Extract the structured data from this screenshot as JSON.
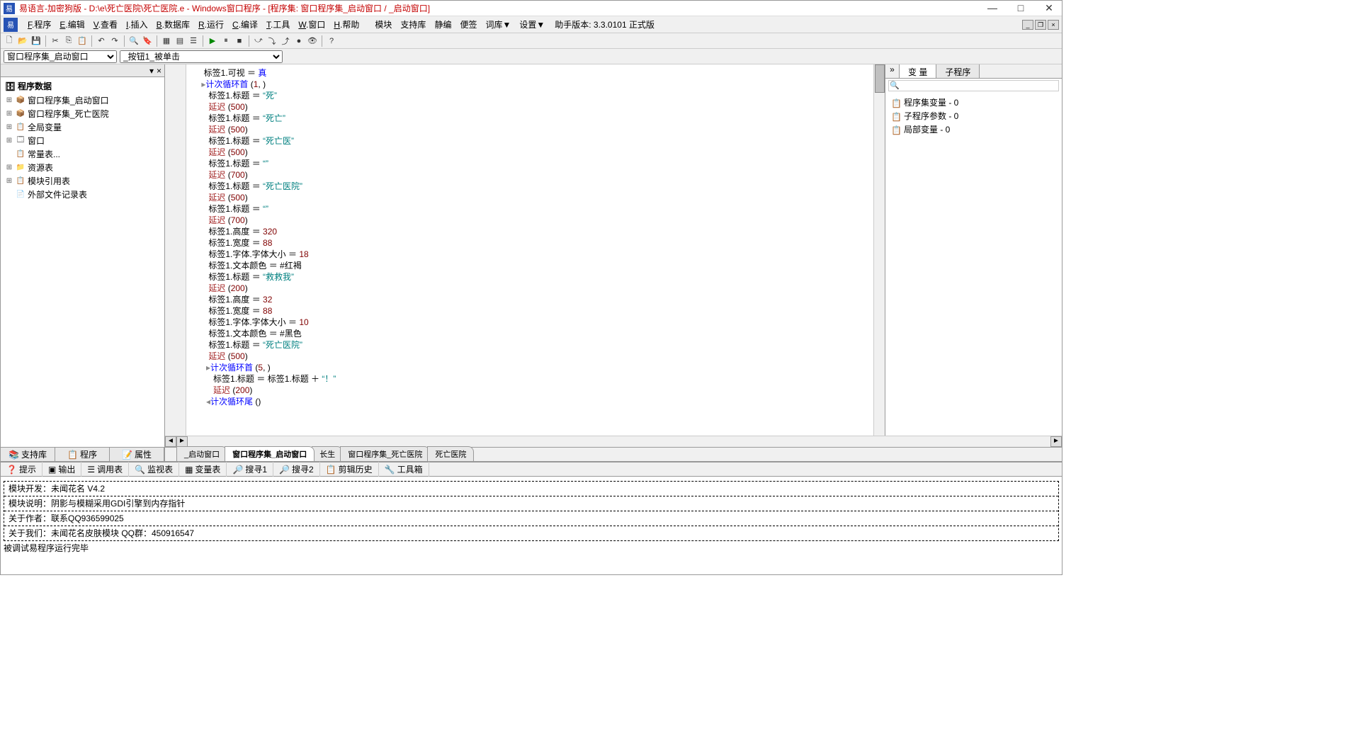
{
  "title": "易语言-加密狗版 - D:\\e\\死亡医院\\死亡医院.e - Windows窗口程序 - [程序集: 窗口程序集_启动窗口 / _启动窗口]",
  "menu": {
    "items": [
      "F.程序",
      "E.编辑",
      "V.查看",
      "I.插入",
      "B.数据库",
      "R.运行",
      "C.编译",
      "T.工具",
      "W.窗口",
      "H.帮助"
    ],
    "extra": [
      "模块",
      "支持库",
      "静编",
      "便签",
      "词库▼",
      "设置▼"
    ],
    "version": "助手版本:  3.3.0101 正式版"
  },
  "dropdowns": {
    "left": "窗口程序集_启动窗口",
    "right": "_按钮1_被单击"
  },
  "tree": {
    "title": "程序数据",
    "nodes": [
      {
        "exp": "+",
        "icon": "📦",
        "label": "窗口程序集_启动窗口"
      },
      {
        "exp": "+",
        "icon": "📦",
        "label": "窗口程序集_死亡医院"
      },
      {
        "exp": "+",
        "icon": "📋",
        "label": "全局变量"
      },
      {
        "exp": "+",
        "icon": "🗔",
        "label": "窗口"
      },
      {
        "exp": "",
        "icon": "📋",
        "label": "常量表..."
      },
      {
        "exp": "+",
        "icon": "📁",
        "label": "资源表"
      },
      {
        "exp": "+",
        "icon": "📋",
        "label": "模块引用表"
      },
      {
        "exp": "",
        "icon": "📄",
        "label": "外部文件记录表"
      }
    ]
  },
  "left_tabs": [
    "支持库",
    "程序",
    "属性"
  ],
  "editor_tabs": [
    {
      "label": "_启动窗口",
      "active": false
    },
    {
      "label": "窗口程序集_启动窗口",
      "active": true
    },
    {
      "label": "长生",
      "active": false
    },
    {
      "label": "窗口程序集_死亡医院",
      "active": false
    },
    {
      "label": "死亡医院",
      "active": false
    }
  ],
  "code_lines": [
    {
      "indent": 2,
      "parts": [
        {
          "t": "标签1.可视",
          "c": "black"
        },
        {
          "t": " ＝ ",
          "c": "op"
        },
        {
          "t": "真",
          "c": "blue"
        }
      ]
    },
    {
      "indent": 2,
      "flow": "start",
      "parts": [
        {
          "t": "计次循环首",
          "c": "blue"
        },
        {
          "t": " (",
          "c": "black"
        },
        {
          "t": "1",
          "c": "red"
        },
        {
          "t": ", )",
          "c": "black"
        }
      ]
    },
    {
      "indent": 3,
      "parts": [
        {
          "t": "标签1.标题",
          "c": "black"
        },
        {
          "t": " ＝ ",
          "c": "op"
        },
        {
          "t": "“死”",
          "c": "teal"
        }
      ]
    },
    {
      "indent": 3,
      "parts": [
        {
          "t": "延迟",
          "c": "brown"
        },
        {
          "t": " (",
          "c": "black"
        },
        {
          "t": "500",
          "c": "red"
        },
        {
          "t": ")",
          "c": "black"
        }
      ]
    },
    {
      "indent": 3,
      "parts": [
        {
          "t": "标签1.标题",
          "c": "black"
        },
        {
          "t": " ＝ ",
          "c": "op"
        },
        {
          "t": "“死亡”",
          "c": "teal"
        }
      ]
    },
    {
      "indent": 3,
      "parts": [
        {
          "t": "延迟",
          "c": "brown"
        },
        {
          "t": " (",
          "c": "black"
        },
        {
          "t": "500",
          "c": "red"
        },
        {
          "t": ")",
          "c": "black"
        }
      ]
    },
    {
      "indent": 3,
      "parts": [
        {
          "t": "标签1.标题",
          "c": "black"
        },
        {
          "t": " ＝ ",
          "c": "op"
        },
        {
          "t": "“死亡医”",
          "c": "teal"
        }
      ]
    },
    {
      "indent": 3,
      "parts": [
        {
          "t": "延迟",
          "c": "brown"
        },
        {
          "t": " (",
          "c": "black"
        },
        {
          "t": "500",
          "c": "red"
        },
        {
          "t": ")",
          "c": "black"
        }
      ]
    },
    {
      "indent": 3,
      "parts": [
        {
          "t": "标签1.标题",
          "c": "black"
        },
        {
          "t": " ＝ ",
          "c": "op"
        },
        {
          "t": "“”",
          "c": "teal"
        }
      ]
    },
    {
      "indent": 3,
      "parts": [
        {
          "t": "延迟",
          "c": "brown"
        },
        {
          "t": " (",
          "c": "black"
        },
        {
          "t": "700",
          "c": "red"
        },
        {
          "t": ")",
          "c": "black"
        }
      ]
    },
    {
      "indent": 3,
      "parts": [
        {
          "t": "标签1.标题",
          "c": "black"
        },
        {
          "t": " ＝ ",
          "c": "op"
        },
        {
          "t": "“死亡医院”",
          "c": "teal"
        }
      ]
    },
    {
      "indent": 3,
      "parts": [
        {
          "t": "延迟",
          "c": "brown"
        },
        {
          "t": " (",
          "c": "black"
        },
        {
          "t": "500",
          "c": "red"
        },
        {
          "t": ")",
          "c": "black"
        }
      ]
    },
    {
      "indent": 3,
      "parts": [
        {
          "t": "标签1.标题",
          "c": "black"
        },
        {
          "t": " ＝ ",
          "c": "op"
        },
        {
          "t": "“”",
          "c": "teal"
        }
      ]
    },
    {
      "indent": 3,
      "parts": [
        {
          "t": "延迟",
          "c": "brown"
        },
        {
          "t": " (",
          "c": "black"
        },
        {
          "t": "700",
          "c": "red"
        },
        {
          "t": ")",
          "c": "black"
        }
      ]
    },
    {
      "indent": 3,
      "parts": [
        {
          "t": "标签1.高度",
          "c": "black"
        },
        {
          "t": " ＝ ",
          "c": "op"
        },
        {
          "t": "320",
          "c": "red"
        }
      ]
    },
    {
      "indent": 3,
      "parts": [
        {
          "t": "标签1.宽度",
          "c": "black"
        },
        {
          "t": " ＝ ",
          "c": "op"
        },
        {
          "t": "88",
          "c": "red"
        }
      ]
    },
    {
      "indent": 3,
      "parts": [
        {
          "t": "标签1.字体.字体大小",
          "c": "black"
        },
        {
          "t": " ＝ ",
          "c": "op"
        },
        {
          "t": "18",
          "c": "red"
        }
      ]
    },
    {
      "indent": 3,
      "parts": [
        {
          "t": "标签1.文本颜色",
          "c": "black"
        },
        {
          "t": " ＝ ",
          "c": "op"
        },
        {
          "t": "#红褐",
          "c": "const"
        }
      ]
    },
    {
      "indent": 3,
      "parts": [
        {
          "t": "标签1.标题",
          "c": "black"
        },
        {
          "t": " ＝ ",
          "c": "op"
        },
        {
          "t": "“救救我”",
          "c": "teal"
        }
      ]
    },
    {
      "indent": 3,
      "parts": [
        {
          "t": "延迟",
          "c": "brown"
        },
        {
          "t": " (",
          "c": "black"
        },
        {
          "t": "200",
          "c": "red"
        },
        {
          "t": ")",
          "c": "black"
        }
      ]
    },
    {
      "indent": 3,
      "parts": [
        {
          "t": "标签1.高度",
          "c": "black"
        },
        {
          "t": " ＝ ",
          "c": "op"
        },
        {
          "t": "32",
          "c": "red"
        }
      ]
    },
    {
      "indent": 3,
      "parts": [
        {
          "t": "标签1.宽度",
          "c": "black"
        },
        {
          "t": " ＝ ",
          "c": "op"
        },
        {
          "t": "88",
          "c": "red"
        }
      ]
    },
    {
      "indent": 3,
      "parts": [
        {
          "t": "标签1.字体.字体大小",
          "c": "black"
        },
        {
          "t": " ＝ ",
          "c": "op"
        },
        {
          "t": "10",
          "c": "red"
        }
      ]
    },
    {
      "indent": 3,
      "parts": [
        {
          "t": "标签1.文本颜色",
          "c": "black"
        },
        {
          "t": " ＝ ",
          "c": "op"
        },
        {
          "t": "#黑色",
          "c": "const"
        }
      ]
    },
    {
      "indent": 3,
      "parts": [
        {
          "t": "标签1.标题",
          "c": "black"
        },
        {
          "t": " ＝ ",
          "c": "op"
        },
        {
          "t": "“死亡医院”",
          "c": "teal"
        }
      ]
    },
    {
      "indent": 3,
      "parts": [
        {
          "t": "延迟",
          "c": "brown"
        },
        {
          "t": " (",
          "c": "black"
        },
        {
          "t": "500",
          "c": "red"
        },
        {
          "t": ")",
          "c": "black"
        }
      ]
    },
    {
      "indent": 3,
      "flow": "start",
      "parts": [
        {
          "t": "计次循环首",
          "c": "blue"
        },
        {
          "t": " (",
          "c": "black"
        },
        {
          "t": "5",
          "c": "red"
        },
        {
          "t": ", )",
          "c": "black"
        }
      ]
    },
    {
      "indent": 4,
      "parts": [
        {
          "t": "标签1.标题",
          "c": "black"
        },
        {
          "t": " ＝ ",
          "c": "op"
        },
        {
          "t": "标签1.标题",
          "c": "black"
        },
        {
          "t": " ＋ ",
          "c": "op"
        },
        {
          "t": "“！”",
          "c": "teal"
        }
      ]
    },
    {
      "indent": 4,
      "parts": [
        {
          "t": "延迟",
          "c": "brown"
        },
        {
          "t": " (",
          "c": "black"
        },
        {
          "t": "200",
          "c": "red"
        },
        {
          "t": ")",
          "c": "black"
        }
      ]
    },
    {
      "indent": 3,
      "flow": "end",
      "parts": [
        {
          "t": "计次循环尾",
          "c": "blue"
        },
        {
          "t": " ()",
          "c": "black"
        }
      ]
    }
  ],
  "right_panel": {
    "tabs": [
      "变 量",
      "子程序"
    ],
    "items": [
      {
        "label": "程序集变量 - 0"
      },
      {
        "label": "子程序参数 - 0"
      },
      {
        "label": "局部变量 - 0"
      }
    ]
  },
  "bottom_tabs": [
    "提示",
    "输出",
    "调用表",
    "监视表",
    "变量表",
    "搜寻1",
    "搜寻2",
    "剪辑历史",
    "工具箱"
  ],
  "bottom_box": [
    "模块开发：未闻花名        V4.2",
    "模块说明：阴影与模糊采用GDI引擎到内存指针",
    "关于作者：联系QQ936599025",
    "关于我们：未闻花名皮肤模块  QQ群：450916547"
  ],
  "bottom_status": "被调试易程序运行完毕"
}
